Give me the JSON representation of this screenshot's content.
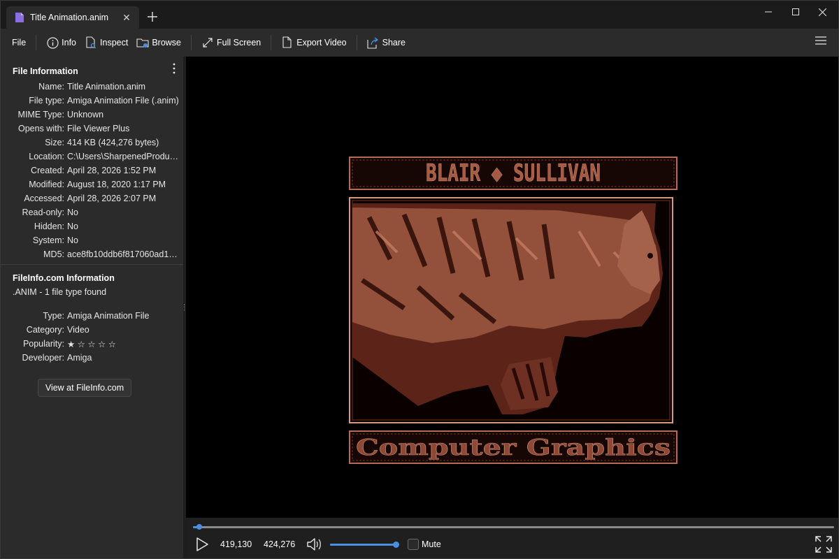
{
  "tab": {
    "title": "Title Animation.anim"
  },
  "toolbar": {
    "file": "File",
    "info": "Info",
    "inspect": "Inspect",
    "browse": "Browse",
    "full_screen": "Full Screen",
    "export_video": "Export Video",
    "share": "Share"
  },
  "sidebar": {
    "file_info_title": "File Information",
    "file_info": [
      {
        "key": "Name:",
        "value": "Title Animation.anim"
      },
      {
        "key": "File type:",
        "value": "Amiga Animation File (.anim)"
      },
      {
        "key": "MIME Type:",
        "value": "Unknown"
      },
      {
        "key": "Opens with:",
        "value": "File Viewer Plus"
      },
      {
        "key": "Size:",
        "value": "414 KB (424,276 bytes)"
      },
      {
        "key": "Location:",
        "value": "C:\\Users\\SharpenedProducti..."
      },
      {
        "key": "Created:",
        "value": "April 28, 2026 1:52 PM"
      },
      {
        "key": "Modified:",
        "value": "August 18, 2020 1:17 PM"
      },
      {
        "key": "Accessed:",
        "value": "April 28, 2026 2:07 PM"
      },
      {
        "key": "Read-only:",
        "value": "No"
      },
      {
        "key": "Hidden:",
        "value": "No"
      },
      {
        "key": "System:",
        "value": "No"
      },
      {
        "key": "MD5:",
        "value": "ace8fb10ddb6f817060ad1ee0..."
      }
    ],
    "fileinfo_title": "FileInfo.com Information",
    "fileinfo_subtitle": ".ANIM - 1 file type found",
    "fileinfo": [
      {
        "key": "Type:",
        "value": "Amiga Animation File"
      },
      {
        "key": "Category:",
        "value": "Video"
      },
      {
        "key": "Popularity:",
        "value": "★ ☆ ☆ ☆ ☆"
      },
      {
        "key": "Developer:",
        "value": "Amiga"
      }
    ],
    "view_button": "View at FileInfo.com"
  },
  "viewer": {
    "banner_top": "BLAIR ◆ SULLIVAN",
    "banner_bottom": "Computer Graphics",
    "art_color": "#b56a52"
  },
  "player": {
    "current": "419,130",
    "total": "424,276",
    "seek_fraction": 0.01,
    "volume_fraction": 1.0,
    "mute_label": "Mute",
    "accent": "#4a90e2"
  }
}
